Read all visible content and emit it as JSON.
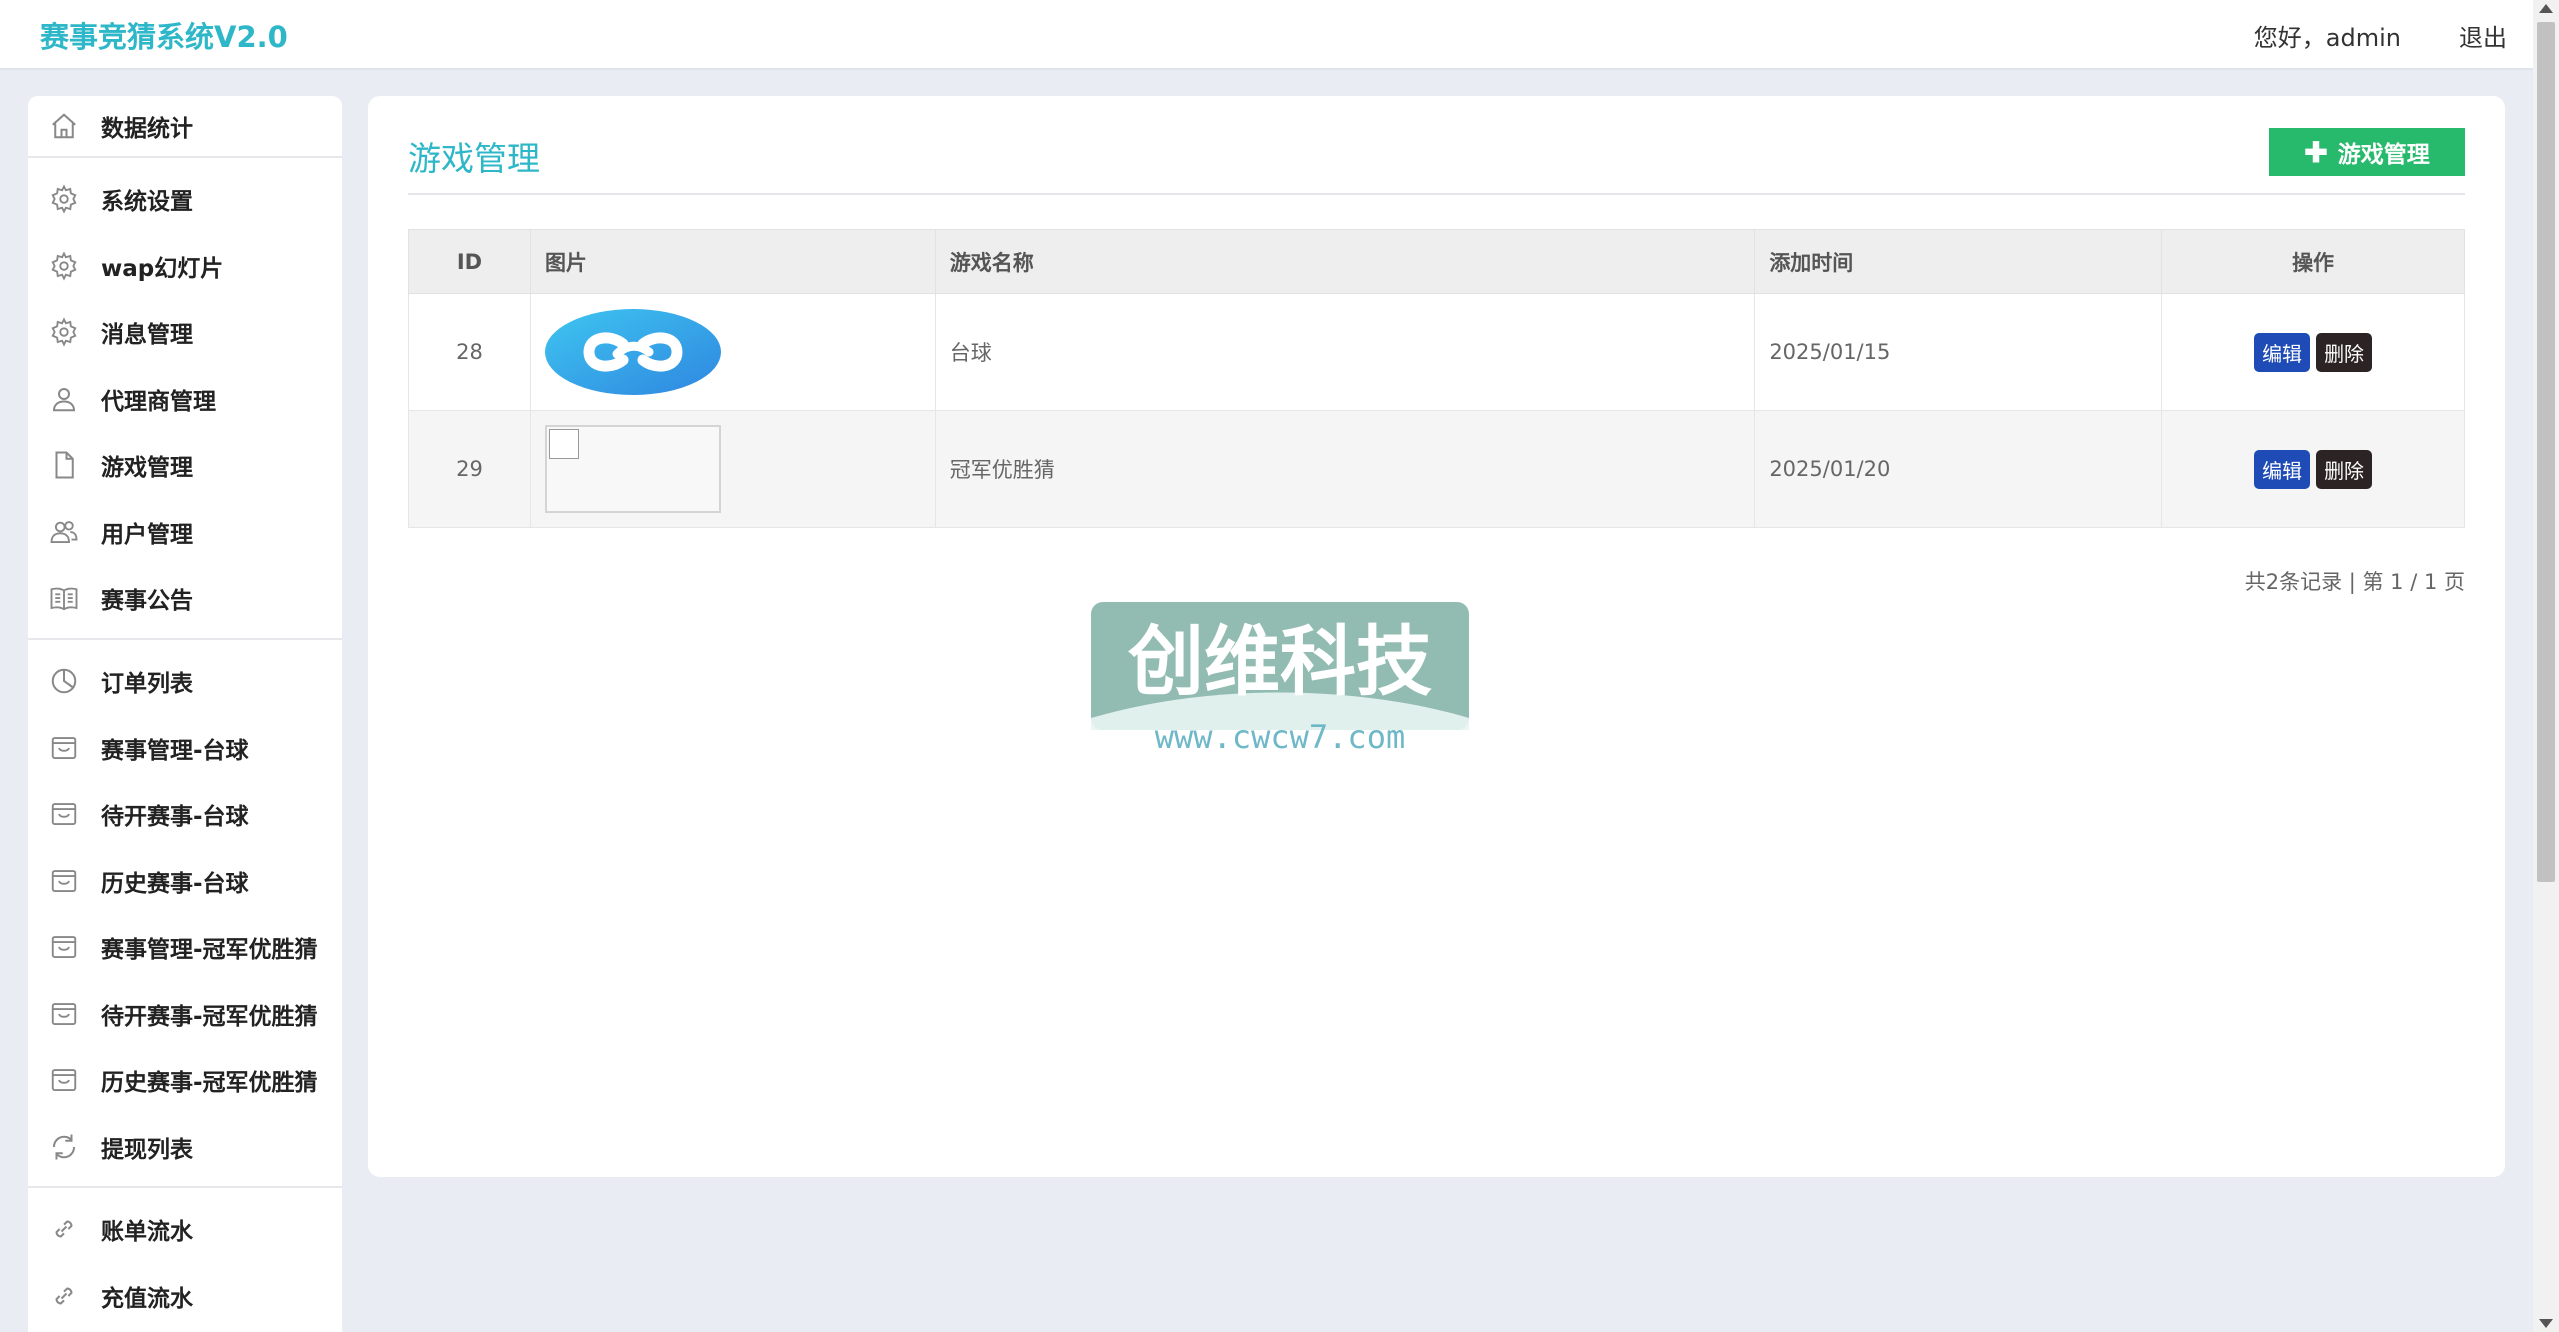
{
  "header": {
    "brand": "赛事竞猜系统V2.0",
    "greeting": "您好，admin",
    "logout": "退出"
  },
  "sidebar": {
    "items": [
      {
        "label": "数据统计",
        "icon": "home-icon"
      },
      {
        "label": "系统设置",
        "icon": "gear-icon"
      },
      {
        "label": "wap幻灯片",
        "icon": "gear-icon"
      },
      {
        "label": "消息管理",
        "icon": "gear-icon"
      },
      {
        "label": "代理商管理",
        "icon": "user-icon"
      },
      {
        "label": "游戏管理",
        "icon": "file-icon"
      },
      {
        "label": "用户管理",
        "icon": "users-icon"
      },
      {
        "label": "赛事公告",
        "icon": "book-icon"
      },
      {
        "label": "订单列表",
        "icon": "pie-chart-icon"
      },
      {
        "label": "赛事管理-台球",
        "icon": "inbox-icon"
      },
      {
        "label": "待开赛事-台球",
        "icon": "inbox-icon"
      },
      {
        "label": "历史赛事-台球",
        "icon": "inbox-icon"
      },
      {
        "label": "赛事管理-冠军优胜猜",
        "icon": "inbox-icon"
      },
      {
        "label": "待开赛事-冠军优胜猜",
        "icon": "inbox-icon"
      },
      {
        "label": "历史赛事-冠军优胜猜",
        "icon": "inbox-icon"
      },
      {
        "label": "提现列表",
        "icon": "refresh-icon"
      },
      {
        "label": "账单流水",
        "icon": "link-icon"
      },
      {
        "label": "充值流水",
        "icon": "link-icon"
      }
    ]
  },
  "main": {
    "title": "游戏管理",
    "add_button": "游戏管理",
    "table": {
      "headers": [
        "ID",
        "图片",
        "游戏名称",
        "添加时间",
        "操作"
      ],
      "rows": [
        {
          "id": "28",
          "name": "台球",
          "time": "2025/01/15",
          "edit": "编辑",
          "delete": "删除"
        },
        {
          "id": "29",
          "name": "冠军优胜猜",
          "time": "2025/01/20",
          "edit": "编辑",
          "delete": "删除"
        }
      ]
    },
    "pagination": "共2条记录 | 第 1 / 1 页"
  },
  "watermark": {
    "text": "创维科技",
    "url": "www.cwcw7.com"
  },
  "colors": {
    "brand": "#2eb7c8",
    "add_button": "#27b96c",
    "edit_button": "#1e4bb5",
    "delete_button": "#2b2324"
  }
}
